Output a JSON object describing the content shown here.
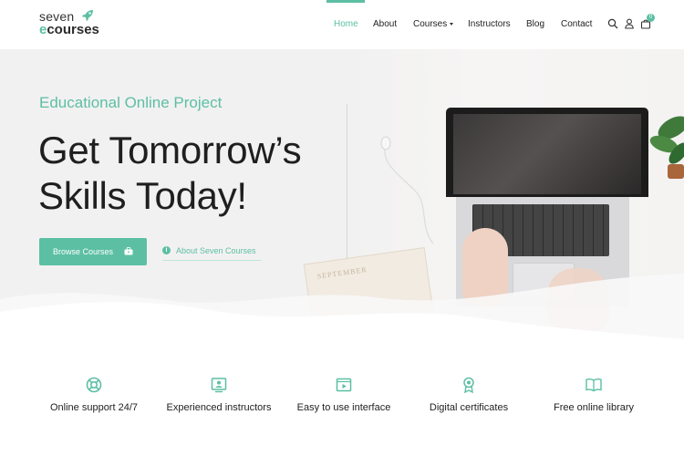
{
  "brand": {
    "line1": "seven",
    "line2_accent": "e",
    "line2_rest": "courses",
    "accent_color": "#5cbfa3"
  },
  "nav": {
    "items": [
      {
        "label": "Home",
        "active": true
      },
      {
        "label": "About",
        "active": false
      },
      {
        "label": "Courses",
        "active": false,
        "dropdown": true
      },
      {
        "label": "Instructors",
        "active": false
      },
      {
        "label": "Blog",
        "active": false
      },
      {
        "label": "Contact",
        "active": false
      }
    ],
    "icons": [
      "search-icon",
      "user-icon",
      "cart-icon"
    ],
    "cart_count": "0"
  },
  "hero": {
    "eyebrow": "Educational Online Project",
    "headline_line1": "Get Tomorrow’s",
    "headline_line2": "Skills Today!",
    "primary_button": "Browse Courses",
    "secondary_link": "About Seven Courses",
    "notebook_text": "SEPTEMBER"
  },
  "features": [
    {
      "icon": "lifebuoy-icon",
      "label": "Online support 24/7"
    },
    {
      "icon": "instructor-screen-icon",
      "label": "Experienced instructors"
    },
    {
      "icon": "video-player-icon",
      "label": "Easy to use interface"
    },
    {
      "icon": "certificate-badge-icon",
      "label": "Digital certificates"
    },
    {
      "icon": "open-book-icon",
      "label": "Free online library"
    }
  ]
}
